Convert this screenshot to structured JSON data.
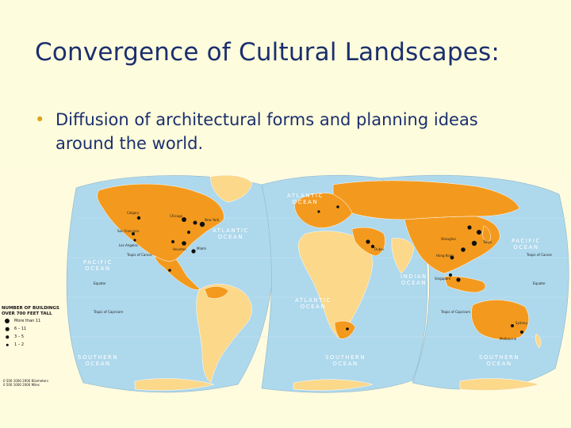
{
  "slide": {
    "title": "Convergence of Cultural Landscapes:",
    "bullet_mark": "•",
    "bullet_text_1": "Diffusion of architectural forms and planning ideas",
    "bullet_text_2": "around the world."
  },
  "map": {
    "ocean_labels": [
      {
        "text": "PACIFIC",
        "text2": "OCEAN"
      },
      {
        "text": "ATLANTIC",
        "text2": "OCEAN"
      },
      {
        "text": "ATLANTIC",
        "text2": "OCEAN"
      },
      {
        "text": "INDIAN",
        "text2": "OCEAN"
      },
      {
        "text": "PACIFIC",
        "text2": "OCEAN"
      },
      {
        "text": "SOUTHERN",
        "text2": "OCEAN"
      },
      {
        "text": "SOUTHERN",
        "text2": "OCEAN"
      },
      {
        "text": "SOUTHERN",
        "text2": "OCEAN"
      },
      {
        "text": "ATLANTIC",
        "text2": "OCEAN"
      }
    ],
    "cities": [
      "Calgary",
      "Chicago",
      "San Francisco",
      "Los Angeles",
      "New York",
      "Houston",
      "Miami",
      "Tokyo",
      "Shanghai",
      "Hong Kong",
      "Singapore",
      "Dubai",
      "Sydney",
      "Melbourne"
    ],
    "latitude_labels": [
      "Tropic of Cancer",
      "Equator",
      "Tropic of Capricorn",
      "Tropic of Cancer",
      "Equator",
      "Tropic of Capricorn"
    ]
  },
  "legend": {
    "title_1": "NUMBER OF BUILDINGS",
    "title_2": "OVER 700 FEET TALL",
    "items": [
      "More than 11",
      "6 – 11",
      "3 – 5",
      "1 – 2"
    ],
    "scale_1": "0     500   1000   2000 Kilometers",
    "scale_2": "0     500   1000   2000 Miles"
  },
  "colors": {
    "background": "#fdfcdc",
    "title": "#1b2f6e",
    "ocean": "#aed8ec",
    "land_highlight": "#f39a1e",
    "land_other": "#fbd88a",
    "bullet": "#e0a316"
  }
}
